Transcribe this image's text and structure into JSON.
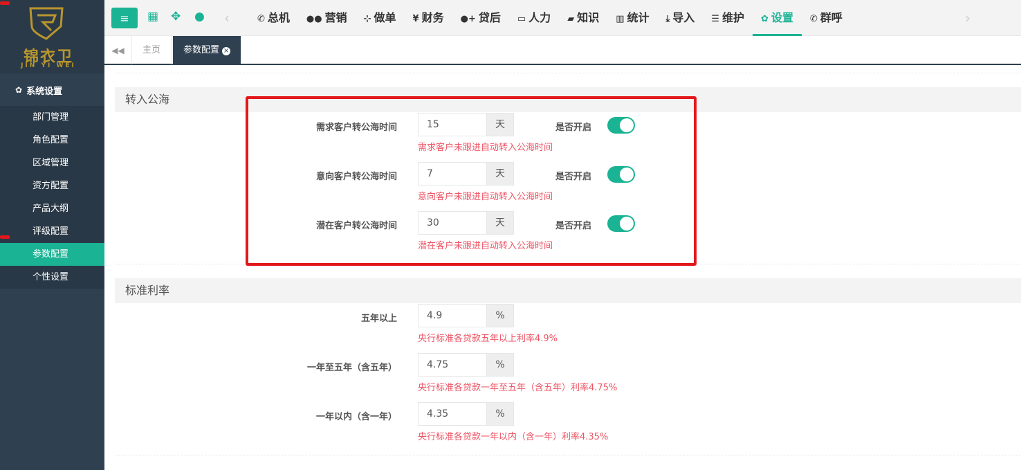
{
  "brand": {
    "name": "锦衣卫",
    "sub": "JIN YI WEI"
  },
  "sidebar": {
    "group": "系统设置",
    "items": [
      "部门管理",
      "角色配置",
      "区域管理",
      "资方配置",
      "产品大纲",
      "评级配置",
      "参数配置",
      "个性设置"
    ],
    "active": "参数配置"
  },
  "topnav": {
    "items": [
      {
        "icon": "phone-icon",
        "label": "总机"
      },
      {
        "icon": "users-icon",
        "label": "营销"
      },
      {
        "icon": "sitemap-icon",
        "label": "做单"
      },
      {
        "icon": "yen-icon",
        "label": "财务"
      },
      {
        "icon": "user-plus-icon",
        "label": "贷后"
      },
      {
        "icon": "id-card-icon",
        "label": "人力"
      },
      {
        "icon": "book-icon",
        "label": "知识"
      },
      {
        "icon": "bar-chart-icon",
        "label": "统计"
      },
      {
        "icon": "download-icon",
        "label": "导入"
      },
      {
        "icon": "database-icon",
        "label": "维护"
      },
      {
        "icon": "gear-icon",
        "label": "设置"
      },
      {
        "icon": "phone-icon",
        "label": "群呼"
      }
    ],
    "active": "设置"
  },
  "tabs": {
    "home": "主页",
    "active": "参数配置"
  },
  "sections": {
    "public_sea": {
      "title": "转入公海",
      "rows": [
        {
          "label": "需求客户转公海时间",
          "value": "15",
          "unit": "天",
          "help": "需求客户未跟进自动转入公海时间",
          "switch_label": "是否开启",
          "enabled": true
        },
        {
          "label": "意向客户转公海时间",
          "value": "7",
          "unit": "天",
          "help": "意向客户未跟进自动转入公海时间",
          "switch_label": "是否开启",
          "enabled": true
        },
        {
          "label": "潜在客户转公海时间",
          "value": "30",
          "unit": "天",
          "help": "潜在客户未跟进自动转入公海时间",
          "switch_label": "是否开启",
          "enabled": true
        }
      ]
    },
    "rate": {
      "title": "标准利率",
      "rows": [
        {
          "label": "五年以上",
          "value": "4.9",
          "unit": "%",
          "help": "央行标准各贷款五年以上利率4.9%"
        },
        {
          "label": "一年至五年（含五年）",
          "value": "4.75",
          "unit": "%",
          "help": "央行标准各贷款一年至五年（含五年）利率4.75%"
        },
        {
          "label": "一年以内（含一年）",
          "value": "4.35",
          "unit": "%",
          "help": "央行标准各贷款一年以内（含一年）利率4.35%"
        }
      ]
    }
  },
  "colors": {
    "accent": "#1ab394",
    "sidebar": "#2f4050",
    "help": "#ed5565",
    "highlight": "#e2171b"
  }
}
